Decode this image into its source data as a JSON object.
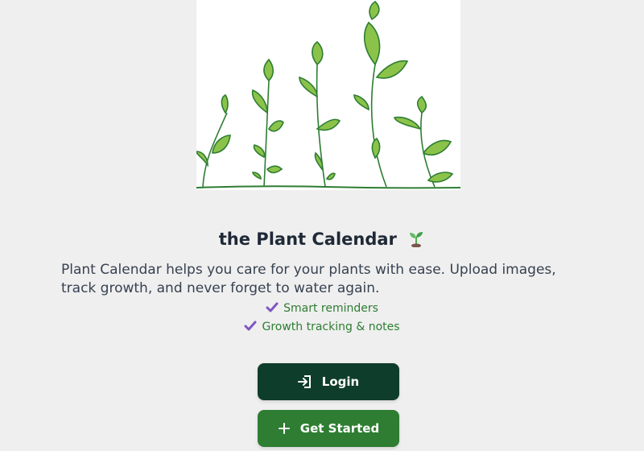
{
  "hero": {
    "icon": "sprouting-plants-illustration"
  },
  "app": {
    "title": "the Plant Calendar",
    "title_emoji": "seedling-icon",
    "description": "Plant Calendar helps you care for your plants with ease. Upload images, track growth, and never forget to water again."
  },
  "features": [
    {
      "label": "Smart reminders",
      "icon": "check-icon"
    },
    {
      "label": "Growth tracking & notes",
      "icon": "check-icon"
    }
  ],
  "buttons": {
    "login": {
      "label": "Login",
      "icon": "login-icon"
    },
    "get_started": {
      "label": "Get Started",
      "icon": "plus-icon"
    }
  },
  "colors": {
    "primary_dark": "#0f3d2b",
    "primary": "#2e7d32",
    "check": "#7e57c2",
    "background": "#efefef"
  }
}
